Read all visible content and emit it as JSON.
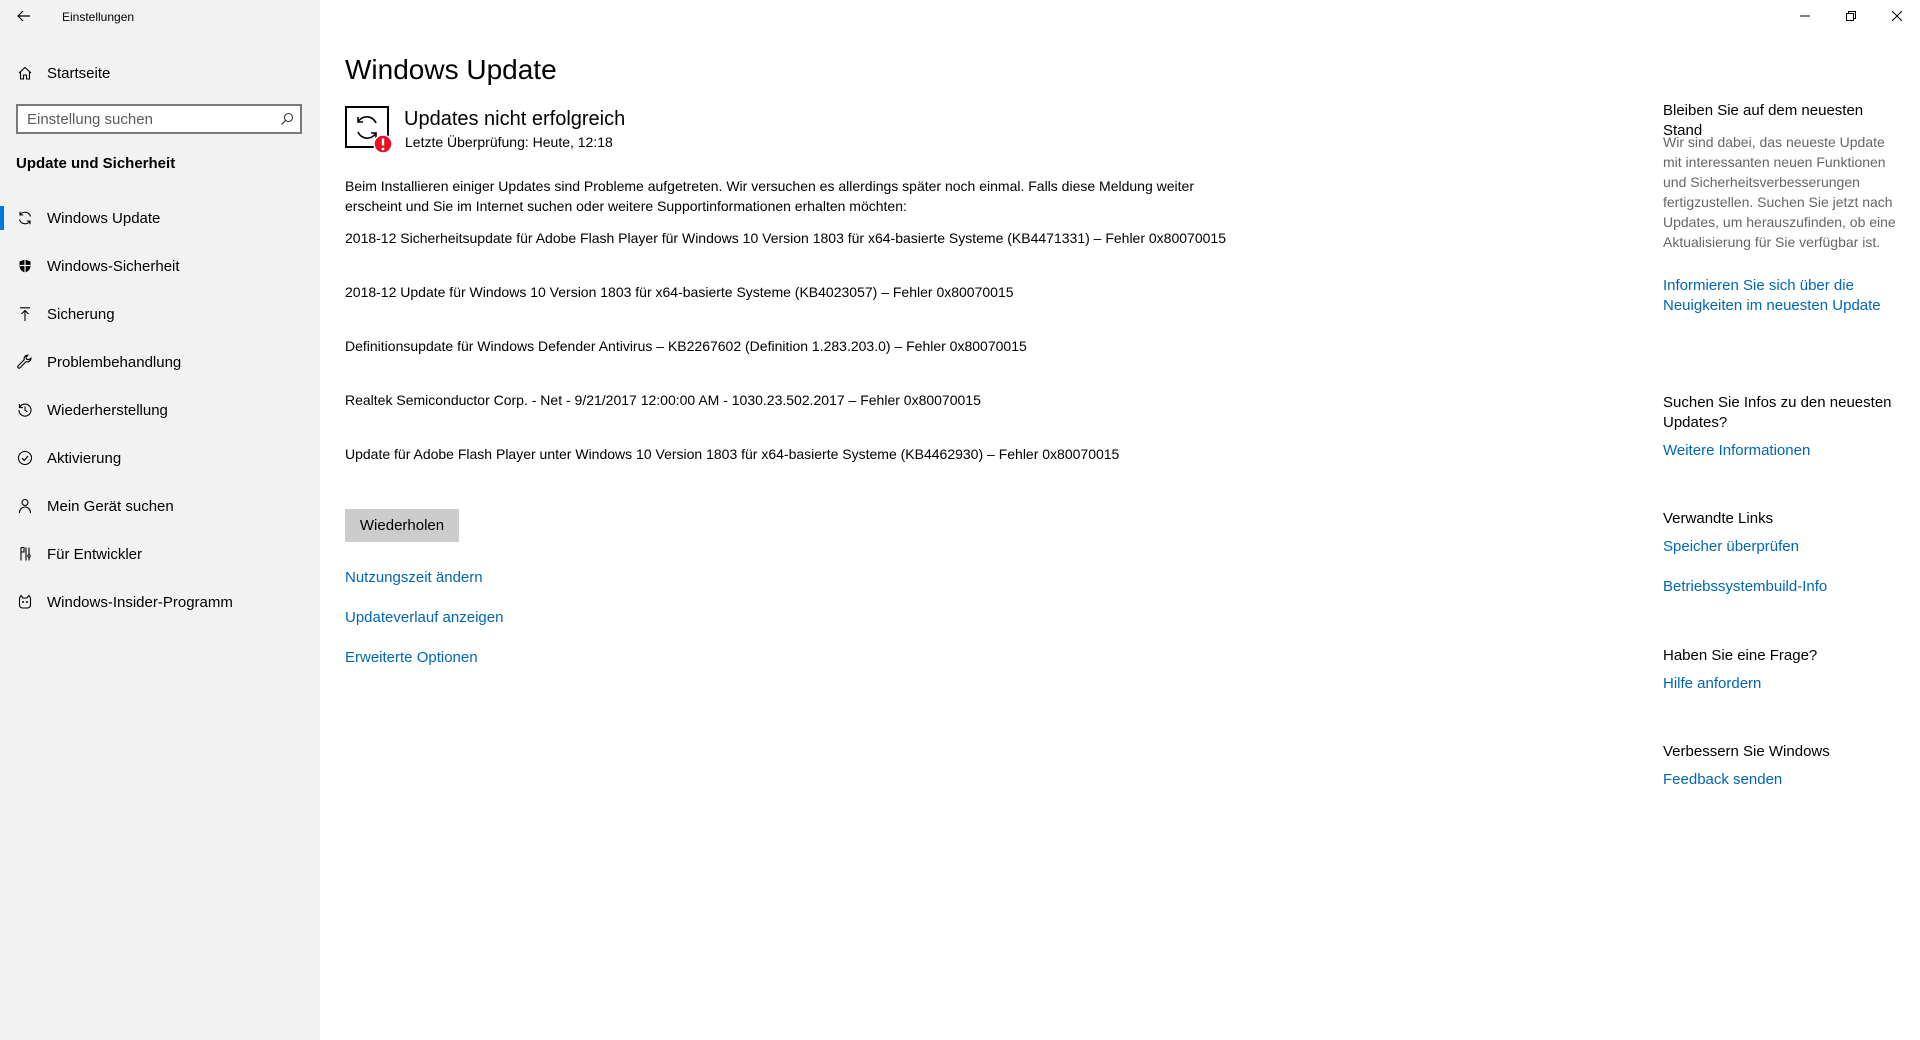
{
  "window": {
    "title": "Einstellungen"
  },
  "sidebar": {
    "home_label": "Startseite",
    "search_placeholder": "Einstellung suchen",
    "section_header": "Update und Sicherheit",
    "items": [
      {
        "label": "Windows Update",
        "icon": "sync-icon",
        "active": true
      },
      {
        "label": "Windows-Sicherheit",
        "icon": "shield-icon",
        "active": false
      },
      {
        "label": "Sicherung",
        "icon": "backup-arrow-icon",
        "active": false
      },
      {
        "label": "Problembehandlung",
        "icon": "wrench-icon",
        "active": false
      },
      {
        "label": "Wiederherstellung",
        "icon": "recovery-icon",
        "active": false
      },
      {
        "label": "Aktivierung",
        "icon": "check-circle-icon",
        "active": false
      },
      {
        "label": "Mein Gerät suchen",
        "icon": "person-location-icon",
        "active": false
      },
      {
        "label": "Für Entwickler",
        "icon": "developer-tools-icon",
        "active": false
      },
      {
        "label": "Windows-Insider-Programm",
        "icon": "insider-cat-icon",
        "active": false
      }
    ]
  },
  "main": {
    "title": "Windows Update",
    "status": {
      "title": "Updates nicht erfolgreich",
      "last_check": "Letzte Überprüfung: Heute, 12:18"
    },
    "intro": "Beim Installieren einiger Updates sind Probleme aufgetreten. Wir versuchen es allerdings später noch einmal. Falls diese Meldung weiter erscheint und Sie im Internet suchen oder weitere Supportinformationen erhalten möchten:",
    "failed_updates": [
      "2018-12 Sicherheitsupdate für Adobe Flash Player für Windows 10 Version 1803 für x64-basierte Systeme (KB4471331) – Fehler 0x80070015",
      "2018-12 Update für Windows 10 Version 1803 für x64-basierte Systeme (KB4023057) – Fehler 0x80070015",
      "Definitionsupdate für Windows Defender Antivirus – KB2267602 (Definition 1.283.203.0) – Fehler 0x80070015",
      "Realtek Semiconductor Corp. - Net - 9/21/2017 12:00:00 AM - 1030.23.502.2017 – Fehler 0x80070015",
      "Update für Adobe Flash Player unter Windows 10 Version 1803 für x64-basierte Systeme (KB4462930) – Fehler 0x80070015"
    ],
    "retry_label": "Wiederholen",
    "links": {
      "active_hours": "Nutzungszeit ändern",
      "history": "Updateverlauf anzeigen",
      "advanced": "Erweiterte Optionen"
    }
  },
  "right_panel": {
    "stay_current": {
      "heading": "Bleiben Sie auf dem neuesten Stand",
      "text": "Wir sind dabei, das neueste Update mit interessanten neuen Funktionen und Sicherheitsverbesserungen fertigzustellen. Suchen Sie jetzt nach Updates, um herauszufinden, ob eine Aktualisierung für Sie verfügbar ist.",
      "link": "Informieren Sie sich über die Neuigkeiten im neuesten Update"
    },
    "info": {
      "heading": "Suchen Sie Infos zu den neuesten Updates?",
      "link": "Weitere Informationen"
    },
    "related": {
      "heading": "Verwandte Links",
      "link1": "Speicher überprüfen",
      "link2": "Betriebssystembuild-Info"
    },
    "question": {
      "heading": "Haben Sie eine Frage?",
      "link": "Hilfe anfordern"
    },
    "improve": {
      "heading": "Verbessern Sie Windows",
      "link": "Feedback senden"
    }
  },
  "colors": {
    "accent": "#0078d7",
    "link": "#0066b4",
    "error": "#e81123",
    "sidebar_bg": "#f2f2f2"
  }
}
